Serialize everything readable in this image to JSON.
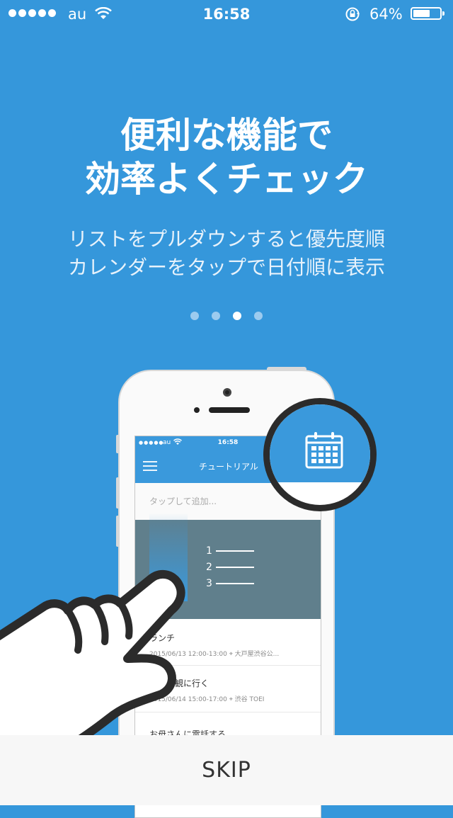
{
  "status_bar": {
    "carrier": "au",
    "time": "16:58",
    "battery_percent": "64%",
    "battery_level": 0.64
  },
  "headline": {
    "line1": "便利な機能で",
    "line2": "効率よくチェック"
  },
  "subtitle": {
    "line1": "リストをプルダウンすると優先度順",
    "line2": "カレンダーをタップで日付順に表示"
  },
  "pager": {
    "count": 4,
    "active_index": 2
  },
  "phone_screen": {
    "status": {
      "carrier": "au",
      "time": "16:58"
    },
    "nav_title": "チュートリアル",
    "input_placeholder": "タップして追加...",
    "priority_labels": [
      "1",
      "2",
      "3"
    ],
    "items": [
      {
        "title": "ランチ",
        "meta": "2015/06/13 12:00-13:00",
        "location": "大戸屋渋谷公..."
      },
      {
        "title": "ライブ観に行く",
        "meta": "2015/06/14 15:00-17:00",
        "location": "渋谷 TOEI"
      },
      {
        "title": "お母さんに電話する",
        "meta": "",
        "location": ""
      }
    ]
  },
  "icons": {
    "magnifier": "calendar-icon",
    "hand": "pointing-hand-icon"
  },
  "colors": {
    "background": "#3597DB",
    "app_blue": "#3A99DC",
    "pull_area": "#607F8C",
    "skip_bar": "#F7F7F7"
  },
  "skip": {
    "label": "SKIP"
  }
}
